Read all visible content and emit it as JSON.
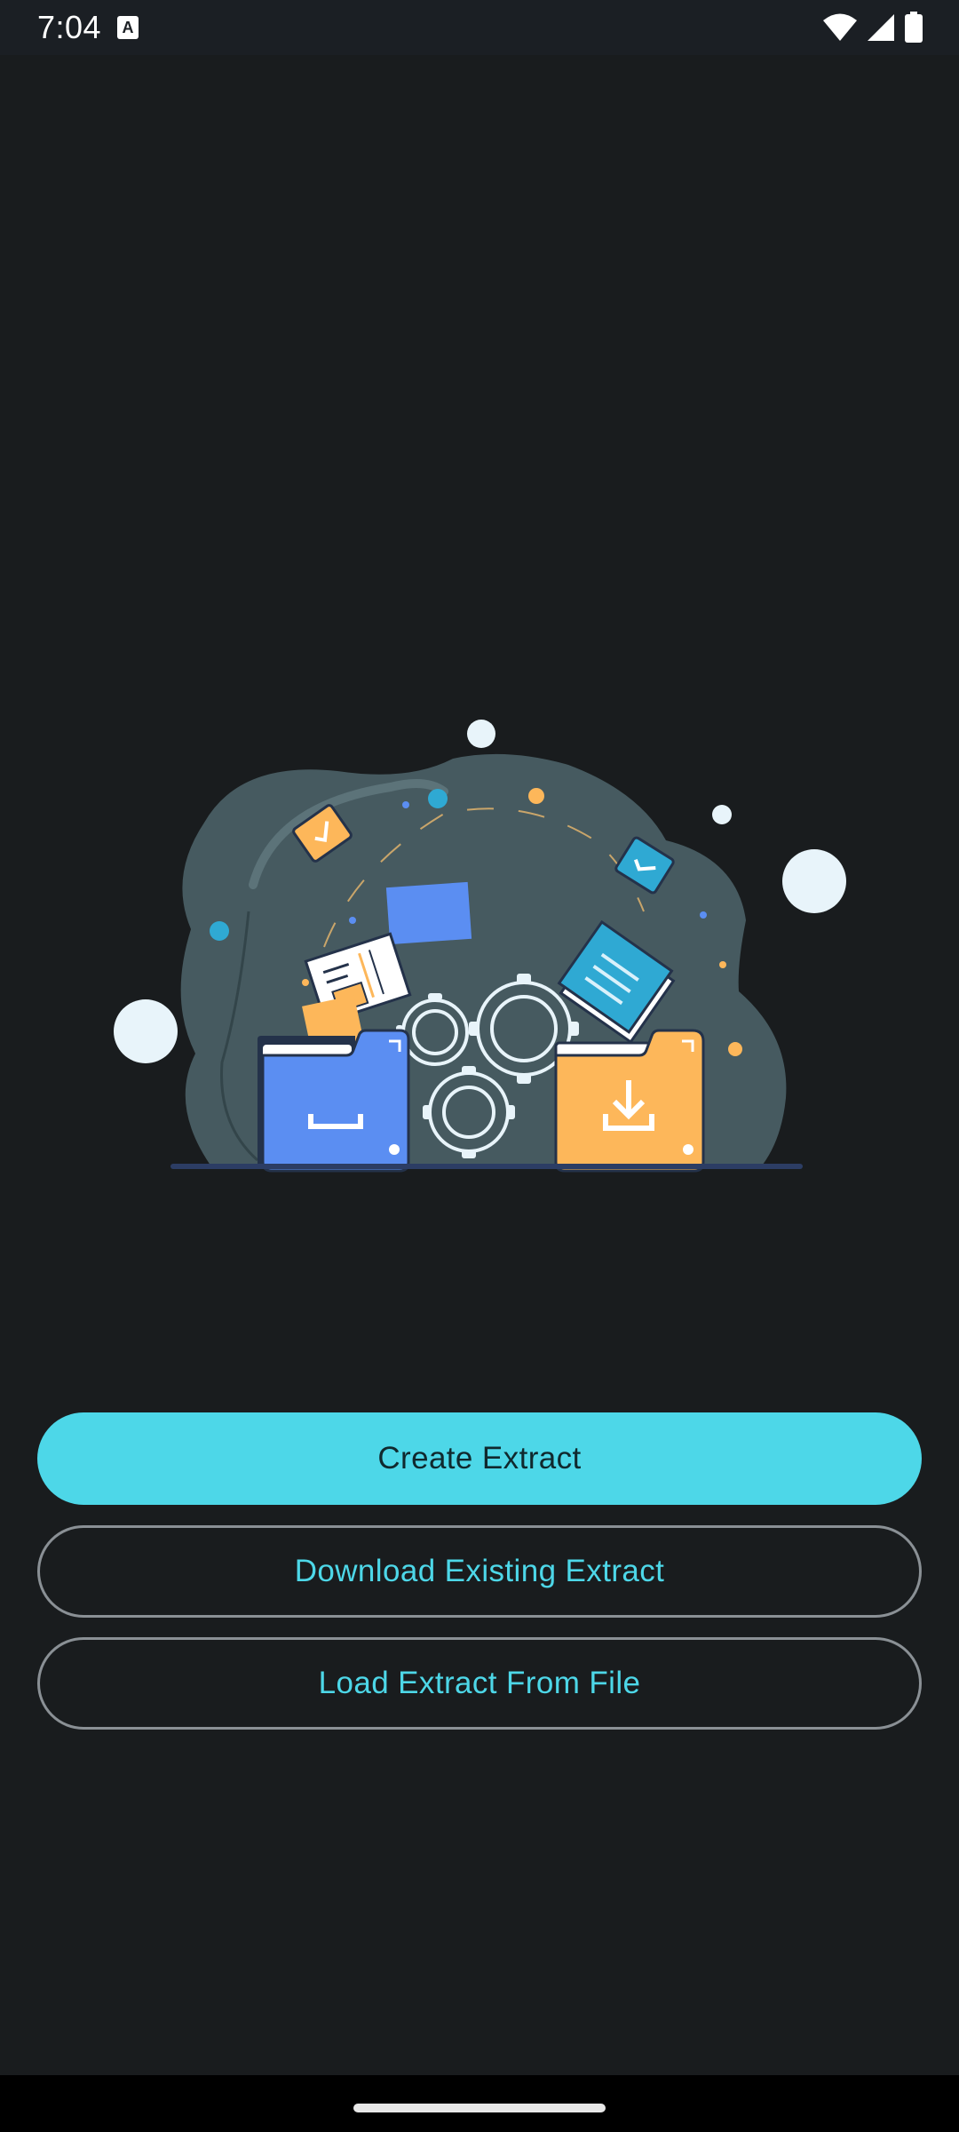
{
  "status_bar": {
    "time": "7:04",
    "notification_icon": "a-notification-icon",
    "icons": [
      "wifi-icon",
      "signal-icon",
      "battery-icon"
    ]
  },
  "illustration": {
    "icon": "files-and-gears-illustration"
  },
  "actions": {
    "create_label": "Create Extract",
    "download_label": "Download Existing Extract",
    "load_label": "Load Extract From File"
  },
  "colors": {
    "background": "#191c1e",
    "accent": "#4dd7e8",
    "outline": "#8a9095",
    "folder_blue": "#5b8ef2",
    "folder_orange": "#fdb75a",
    "blob": "#465a60"
  }
}
